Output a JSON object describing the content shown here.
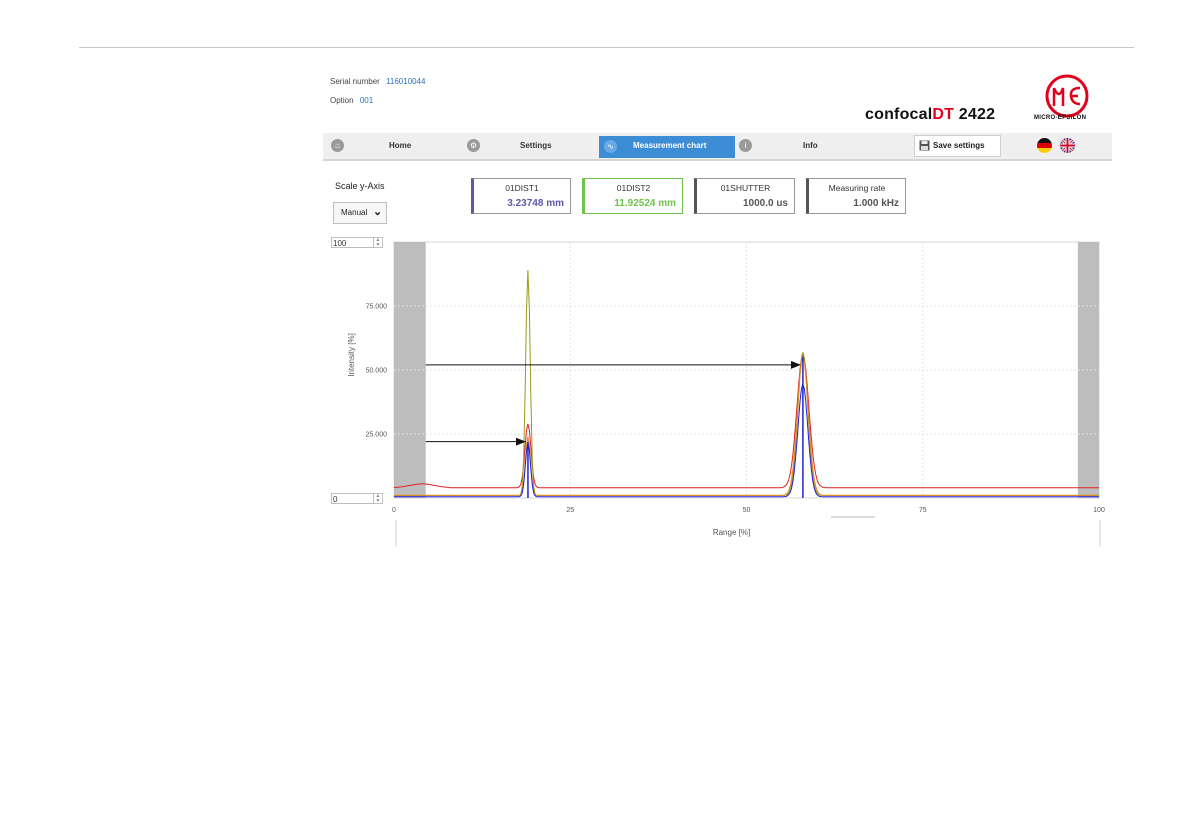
{
  "device": {
    "serial_label": "Serial number",
    "serial_value": "116010044",
    "option_label": "Option",
    "option_value": "001",
    "brand_prefix": "confocal",
    "brand_highlight": "DT",
    "brand_model": "2422",
    "logo_text": "MICRO-EPSILON"
  },
  "nav": {
    "home": "Home",
    "settings": "Settings",
    "measurement_chart": "Measurement chart",
    "info": "Info",
    "save_settings": "Save settings"
  },
  "scale": {
    "label": "Scale y-Axis",
    "mode": "Manual",
    "max": "100",
    "min": "0"
  },
  "readouts": [
    {
      "label": "01DIST1",
      "value": "3.23748 mm",
      "color": "#5a5aa8"
    },
    {
      "label": "01DIST2",
      "value": "11.92524 mm",
      "color": "#6cc24a"
    },
    {
      "label": "01SHUTTER",
      "value": "1000.0 us",
      "color": "#555555"
    },
    {
      "label": "Measuring rate",
      "value": "1.000 kHz",
      "color": "#555555"
    }
  ],
  "chart_data": {
    "type": "line",
    "xlabel": "Range [%]",
    "ylabel": "Intensity [%]",
    "xlim": [
      0,
      100
    ],
    "ylim": [
      0,
      100
    ],
    "x_ticks": [
      "0",
      "25",
      "50",
      "75",
      "100"
    ],
    "y_ticks": [
      "25.000",
      "50.000",
      "75.000"
    ],
    "grid": true,
    "masked_ranges": [
      [
        0,
        4.5
      ],
      [
        97,
        100
      ]
    ],
    "series": [
      {
        "color": "#e02020",
        "baseline": 4,
        "peaks": [
          {
            "x": 19,
            "y": 25,
            "w": 0.6
          },
          {
            "x": 58,
            "y": 52,
            "w": 1.2
          }
        ]
      },
      {
        "color": "#9a9a1a",
        "baseline": 1,
        "peaks": [
          {
            "x": 19,
            "y": 88,
            "w": 0.45
          },
          {
            "x": 58,
            "y": 56,
            "w": 1.0
          }
        ]
      },
      {
        "color": "#e08a20",
        "baseline": 1,
        "peaks": [
          {
            "x": 19,
            "y": 23,
            "w": 0.5
          },
          {
            "x": 58,
            "y": 54,
            "w": 1.1
          }
        ]
      },
      {
        "color": "#2020d8",
        "baseline": 0.5,
        "peaks": [
          {
            "x": 19,
            "y": 21,
            "w": 0.5
          },
          {
            "x": 58,
            "y": 44,
            "w": 1.0
          }
        ]
      }
    ],
    "markers": [
      {
        "x": 19,
        "y": 22,
        "color": "#2020d8"
      },
      {
        "x": 58,
        "y": 55,
        "color": "#2020d8"
      }
    ],
    "arrows": [
      {
        "from_x": 4.5,
        "to_x": 19,
        "y": 22
      },
      {
        "from_x": 4.5,
        "to_x": 58,
        "y": 52
      }
    ]
  },
  "colors": {
    "accent": "#3c8dd6",
    "brand_red": "#e2001a"
  }
}
